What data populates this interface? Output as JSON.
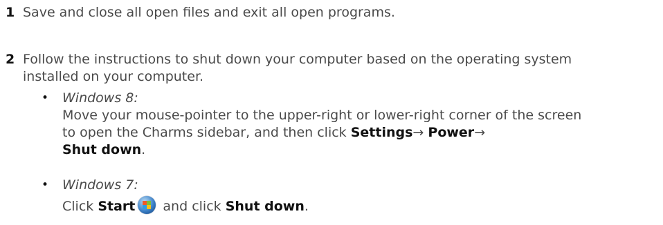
{
  "steps": [
    {
      "number": "1",
      "text": "Save and close all open files and exit all open programs."
    },
    {
      "number": "2",
      "text": "Follow the instructions to shut down your computer based on the operating system installed on your computer."
    }
  ],
  "bullets": [
    {
      "symbol": "•",
      "heading": "Windows 8:",
      "desc_pre": "Move your mouse-pointer to the upper-right or lower-right corner of the screen to open the Charms sidebar, and then click ",
      "settings": "Settings",
      "arrow1": "→ ",
      "power": "Power",
      "arrow2": "→ ",
      "shutdown": "Shut down",
      "period": "."
    },
    {
      "symbol": "•",
      "heading": "Windows 7:",
      "click": "Click ",
      "start": "Start",
      "and_click": " and click ",
      "shutdown": "Shut down",
      "period": ".",
      "icon": "windows-start-orb-icon"
    }
  ]
}
